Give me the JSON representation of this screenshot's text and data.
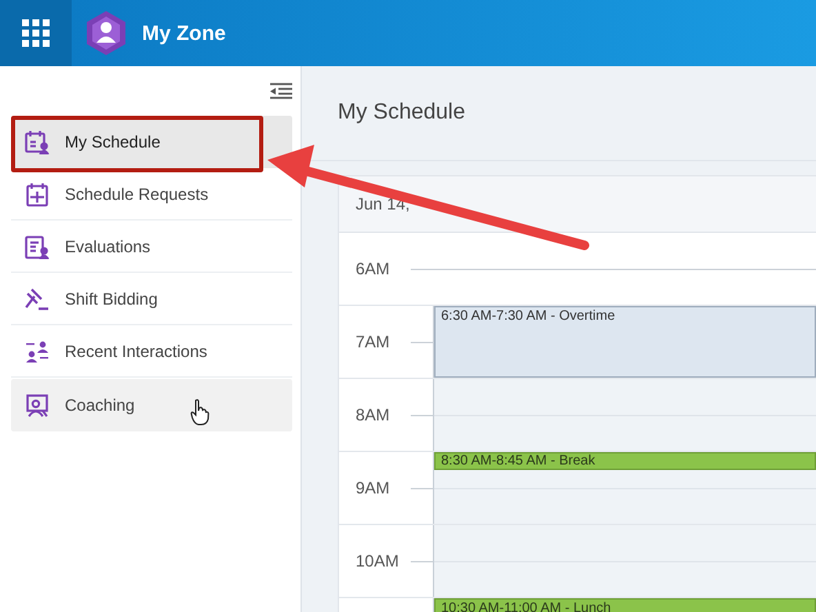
{
  "header": {
    "title": "My Zone"
  },
  "sidebar": {
    "items": [
      {
        "label": "My Schedule",
        "selected": true,
        "hovered": false
      },
      {
        "label": "Schedule Requests",
        "selected": false,
        "hovered": false
      },
      {
        "label": "Evaluations",
        "selected": false,
        "hovered": false
      },
      {
        "label": "Shift Bidding",
        "selected": false,
        "hovered": false
      },
      {
        "label": "Recent Interactions",
        "selected": false,
        "hovered": false
      },
      {
        "label": "Coaching",
        "selected": false,
        "hovered": true
      }
    ]
  },
  "main": {
    "title": "My Schedule",
    "date": "Jun 14,",
    "hours": [
      {
        "label": "6AM"
      },
      {
        "label": "7AM",
        "events": [
          {
            "kind": "overtime",
            "text": "6:30 AM-7:30 AM - Overtime"
          }
        ]
      },
      {
        "label": "8AM"
      },
      {
        "label": "9AM",
        "events": [
          {
            "kind": "break",
            "text": "8:30 AM-8:45 AM - Break"
          }
        ]
      },
      {
        "label": "10AM"
      },
      {
        "events": [
          {
            "kind": "lunch",
            "text": "10:30 AM-11:00 AM - Lunch"
          }
        ]
      }
    ]
  }
}
